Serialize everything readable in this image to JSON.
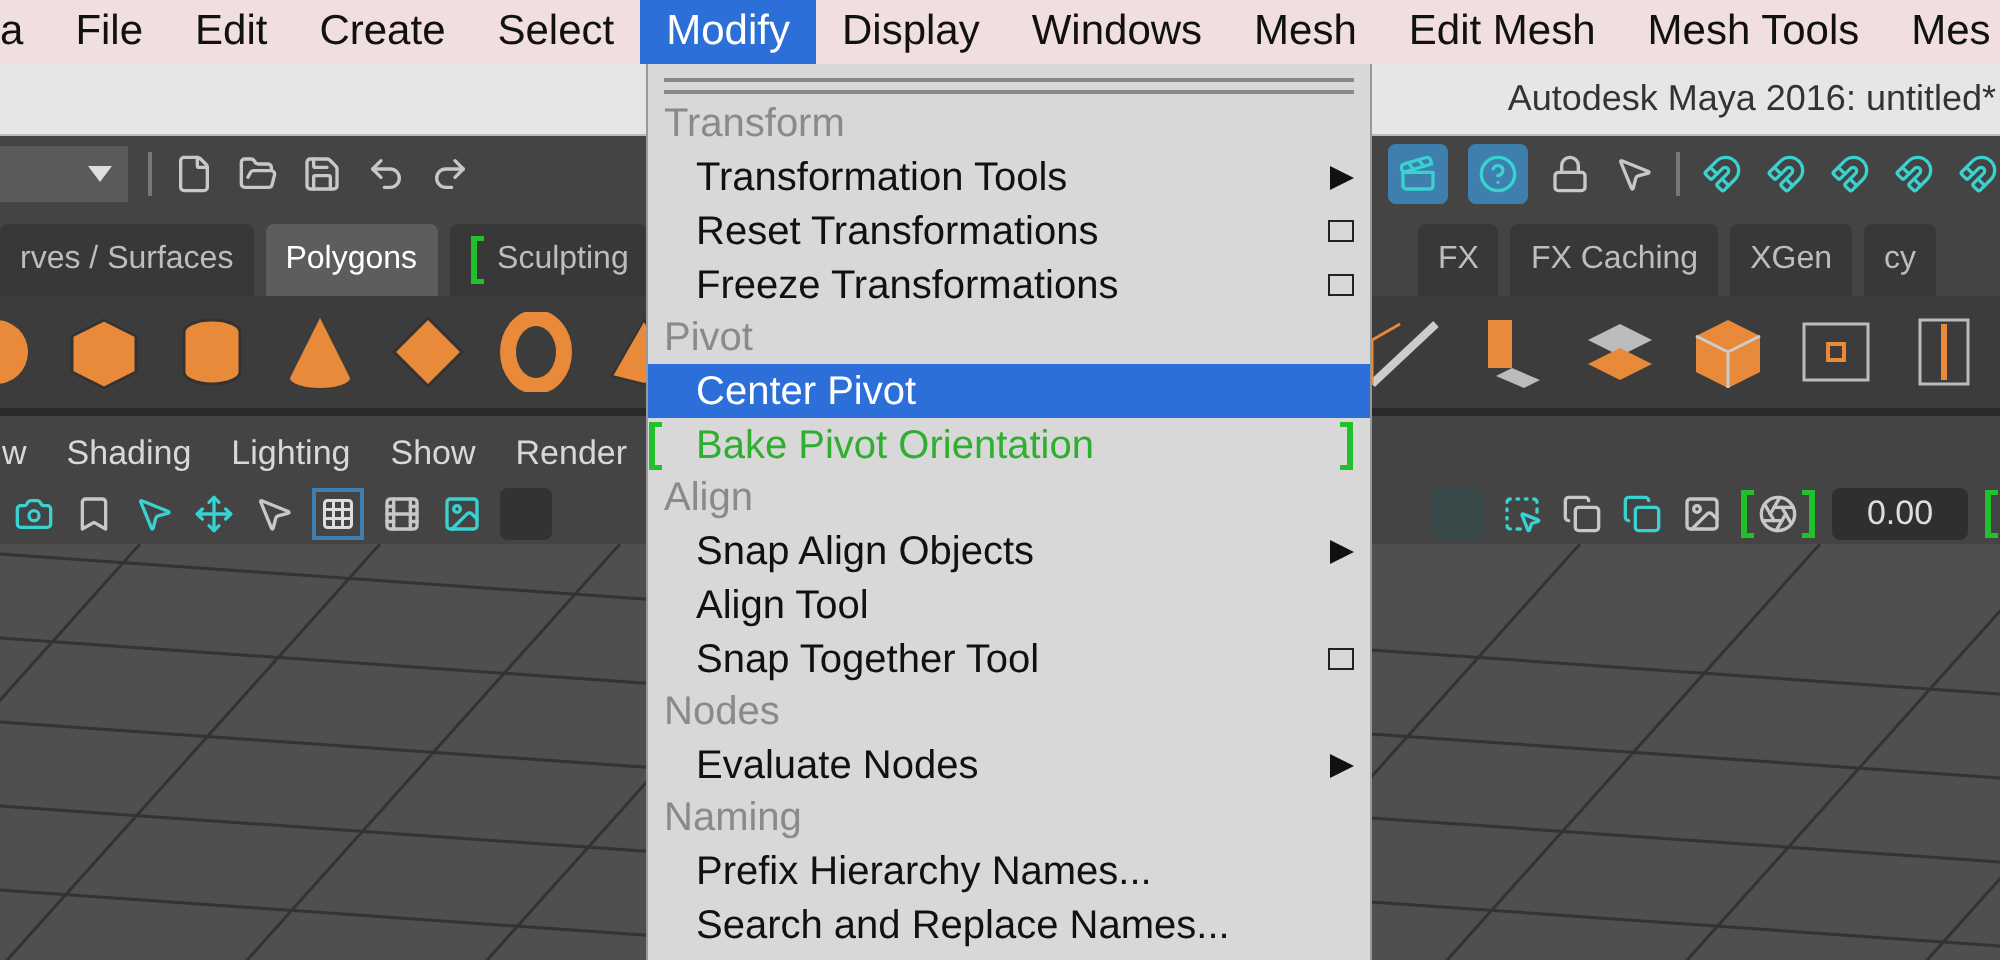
{
  "menubar": {
    "items": [
      {
        "label": "a",
        "selected": false
      },
      {
        "label": "File",
        "selected": false
      },
      {
        "label": "Edit",
        "selected": false
      },
      {
        "label": "Create",
        "selected": false
      },
      {
        "label": "Select",
        "selected": false
      },
      {
        "label": "Modify",
        "selected": true
      },
      {
        "label": "Display",
        "selected": false
      },
      {
        "label": "Windows",
        "selected": false
      },
      {
        "label": "Mesh",
        "selected": false
      },
      {
        "label": "Edit Mesh",
        "selected": false
      },
      {
        "label": "Mesh Tools",
        "selected": false
      },
      {
        "label": "Mes",
        "selected": false
      }
    ]
  },
  "window": {
    "title": "Autodesk Maya 2016: untitled*"
  },
  "shelf": {
    "left_tabs": [
      {
        "label": "rves / Surfaces",
        "selected": false,
        "bracketed": false
      },
      {
        "label": "Polygons",
        "selected": true,
        "bracketed": false
      },
      {
        "label": "Sculpting",
        "selected": false,
        "bracketed": true
      }
    ],
    "right_tabs": [
      {
        "label": "FX",
        "selected": false,
        "bracketed": false
      },
      {
        "label": "FX Caching",
        "selected": false,
        "bracketed": false
      },
      {
        "label": "XGen",
        "selected": false,
        "bracketed": false
      },
      {
        "label": "cy",
        "selected": false,
        "bracketed": false
      }
    ]
  },
  "panel_menu": {
    "items": [
      "w",
      "Shading",
      "Lighting",
      "Show",
      "Render"
    ]
  },
  "panel_toolbar": {
    "field_value": "0.00"
  },
  "menu": {
    "sections": [
      {
        "title": "Transform",
        "items": [
          {
            "label": "Transformation Tools",
            "kind": "submenu",
            "selected": false,
            "bracketed": false
          },
          {
            "label": "Reset Transformations",
            "kind": "option",
            "selected": false,
            "bracketed": false
          },
          {
            "label": "Freeze Transformations",
            "kind": "option",
            "selected": false,
            "bracketed": false
          }
        ]
      },
      {
        "title": "Pivot",
        "items": [
          {
            "label": "Center Pivot",
            "kind": "plain",
            "selected": true,
            "bracketed": false
          },
          {
            "label": "Bake Pivot Orientation",
            "kind": "plain",
            "selected": false,
            "bracketed": true
          }
        ]
      },
      {
        "title": "Align",
        "items": [
          {
            "label": "Snap Align Objects",
            "kind": "submenu",
            "selected": false,
            "bracketed": false
          },
          {
            "label": "Align Tool",
            "kind": "plain",
            "selected": false,
            "bracketed": false
          },
          {
            "label": "Snap Together Tool",
            "kind": "option",
            "selected": false,
            "bracketed": false
          }
        ]
      },
      {
        "title": "Nodes",
        "items": [
          {
            "label": "Evaluate Nodes",
            "kind": "submenu",
            "selected": false,
            "bracketed": false
          }
        ]
      },
      {
        "title": "Naming",
        "items": [
          {
            "label": "Prefix Hierarchy Names...",
            "kind": "plain",
            "selected": false,
            "bracketed": false
          },
          {
            "label": "Search and Replace Names...",
            "kind": "plain",
            "selected": false,
            "bracketed": false
          }
        ]
      }
    ]
  }
}
